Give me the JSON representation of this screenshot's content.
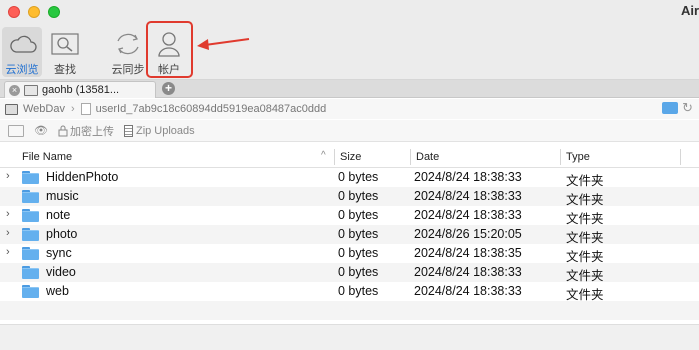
{
  "window": {
    "title": "Air"
  },
  "toolbar": {
    "cloud_browse_label": "云浏览",
    "search_label": "查找",
    "sync_label": "云同步",
    "account_label": "帐户"
  },
  "tab": {
    "title": "gaohb (13581..."
  },
  "path": {
    "root": "WebDav",
    "folder": "userId_7ab9c18c60894dd5919ea08487ac0ddd"
  },
  "actions": {
    "encrypt_upload_label": "加密上传",
    "zip_uploads_label": "Zip Uploads"
  },
  "table": {
    "columns": {
      "name": "File Name",
      "size": "Size",
      "date": "Date",
      "type": "Type"
    },
    "rows": [
      {
        "name": "HiddenPhoto",
        "size": "0 bytes",
        "date": "2024/8/24 18:38:33",
        "type": "文件夹",
        "expandable": true
      },
      {
        "name": "music",
        "size": "0 bytes",
        "date": "2024/8/24 18:38:33",
        "type": "文件夹",
        "expandable": false
      },
      {
        "name": "note",
        "size": "0 bytes",
        "date": "2024/8/24 18:38:33",
        "type": "文件夹",
        "expandable": true
      },
      {
        "name": "photo",
        "size": "0 bytes",
        "date": "2024/8/26 15:20:05",
        "type": "文件夹",
        "expandable": true
      },
      {
        "name": "sync",
        "size": "0 bytes",
        "date": "2024/8/24 18:38:35",
        "type": "文件夹",
        "expandable": true
      },
      {
        "name": "video",
        "size": "0 bytes",
        "date": "2024/8/24 18:38:33",
        "type": "文件夹",
        "expandable": false
      },
      {
        "name": "web",
        "size": "0 bytes",
        "date": "2024/8/24 18:38:33",
        "type": "文件夹",
        "expandable": false
      }
    ]
  },
  "colors": {
    "accent": "#1f6fd1",
    "highlight": "#e03a2e",
    "folder": "#64b0ee"
  },
  "icons": {
    "expander": "chevron-right-icon",
    "folder": "folder-icon"
  }
}
